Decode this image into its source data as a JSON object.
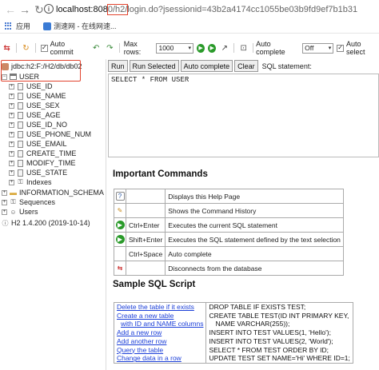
{
  "browser": {
    "url_host": "localhost:808",
    "url_highlight": "0/h2/",
    "url_rest": "login.do?jsessionid=43b2a4174cc1055be03b9fd9ef7b1b31"
  },
  "bookmarks": [
    {
      "label": "应用"
    },
    {
      "label": "测速网 - 在线网速..."
    }
  ],
  "toolbar": {
    "auto_commit_label": "Auto commit",
    "max_rows_label": "Max rows:",
    "max_rows_value": "1000",
    "auto_complete_label": "Auto complete",
    "auto_complete_value": "Off",
    "auto_select_label": "Auto select"
  },
  "tree": {
    "connection": "jdbc:h2:F:/H2/db/db02",
    "table": "USER",
    "columns": [
      "USE_ID",
      "USE_NAME",
      "USE_SEX",
      "USE_AGE",
      "USE_ID_NO",
      "USE_PHONE_NUM",
      "USE_EMAIL",
      "CREATE_TIME",
      "MODIFY_TIME",
      "USE_STATE"
    ],
    "indexes": "Indexes",
    "schema": "INFORMATION_SCHEMA",
    "sequences": "Sequences",
    "users": "Users",
    "version": "H2 1.4.200 (2019-10-14)"
  },
  "sql_panel": {
    "run": "Run",
    "run_selected": "Run Selected",
    "auto_complete": "Auto complete",
    "clear": "Clear",
    "label": "SQL statement:",
    "query": "SELECT * FROM USER"
  },
  "important": {
    "title": "Important Commands",
    "rows": [
      {
        "key": "",
        "desc": "Displays this Help Page"
      },
      {
        "key": "",
        "desc": "Shows the Command History"
      },
      {
        "key": "Ctrl+Enter",
        "desc": "Executes the current SQL statement"
      },
      {
        "key": "Shift+Enter",
        "desc": "Executes the SQL statement defined by the text selection"
      },
      {
        "key": "Ctrl+Space",
        "desc": "Auto complete"
      },
      {
        "key": "",
        "desc": "Disconnects from the database"
      }
    ]
  },
  "sample": {
    "title": "Sample SQL Script",
    "links": [
      "Delete the table if it exists",
      "Create a new table",
      "with ID and NAME columns",
      "Add a new row",
      "Add another row",
      "Query the table",
      "Change data in a row"
    ],
    "code": [
      "DROP TABLE IF EXISTS TEST;",
      "CREATE TABLE TEST(ID INT PRIMARY KEY,",
      "NAME VARCHAR(255));",
      "INSERT INTO TEST VALUES(1, 'Hello');",
      "INSERT INTO TEST VALUES(2, 'World');",
      "SELECT * FROM TEST ORDER BY ID;",
      "UPDATE TEST SET NAME='Hi' WHERE ID=1;"
    ]
  },
  "colors": {
    "highlight_red": "#e2442f",
    "link_blue": "#1a3ed8"
  }
}
